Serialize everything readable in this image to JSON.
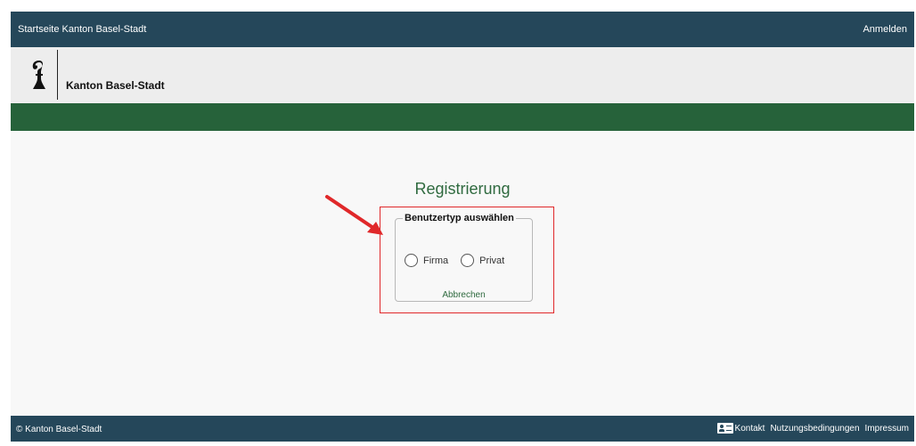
{
  "header": {
    "home_link": "Startseite Kanton Basel-Stadt",
    "login_link": "Anmelden"
  },
  "brand": {
    "name": "Kanton Basel-Stadt",
    "logo_icon": "basel-staff-icon"
  },
  "main": {
    "title": "Registrierung",
    "usertype": {
      "legend": "Benutzertyp auswählen",
      "options": [
        {
          "label": "Firma",
          "selected": false
        },
        {
          "label": "Privat",
          "selected": false
        }
      ],
      "cancel_label": "Abbrechen"
    }
  },
  "footer": {
    "copyright": "© Kanton Basel-Stadt",
    "links": {
      "contact": "Kontakt",
      "terms": "Nutzungsbedingungen",
      "imprint": "Impressum"
    },
    "contact_icon": "contact-card-icon"
  },
  "colors": {
    "header_bg": "#25475a",
    "accent_green": "#26623a",
    "highlight_red": "#e0282a"
  }
}
